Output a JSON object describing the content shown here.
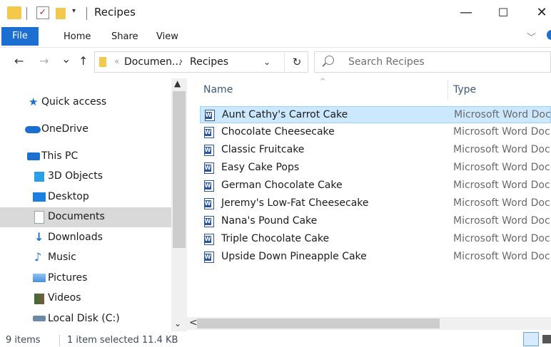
{
  "window": {
    "title": "Recipes",
    "minimize": "—",
    "maximize": "☐",
    "close": "✕"
  },
  "ribbon": {
    "tabs": [
      "File",
      "Home",
      "Share",
      "View"
    ]
  },
  "nav": {
    "back": "←",
    "forward": "→",
    "recent": "⌄",
    "up": "↑",
    "breadcrumb": [
      "Documen...",
      "Recipes"
    ],
    "refresh": "↻",
    "search_placeholder": "Search Recipes"
  },
  "sidebar": {
    "items": [
      {
        "label": "Quick access",
        "icon": "star-icon",
        "color": "#1a6fd0"
      },
      {
        "label": "OneDrive",
        "icon": "cloud-icon",
        "color": "#1a6fd0"
      },
      {
        "label": "This PC",
        "icon": "computer-icon",
        "color": "#1a6fd0"
      },
      {
        "label": "3D Objects",
        "icon": "cube-icon",
        "color": "#2aa0e8"
      },
      {
        "label": "Desktop",
        "icon": "desktop-icon",
        "color": "#1a7fe0"
      },
      {
        "label": "Documents",
        "icon": "documents-icon",
        "color": "#9aa4ad",
        "selected": true
      },
      {
        "label": "Downloads",
        "icon": "download-arrow-icon",
        "color": "#1a6fd0"
      },
      {
        "label": "Music",
        "icon": "music-note-icon",
        "color": "#1a6fd0"
      },
      {
        "label": "Pictures",
        "icon": "pictures-icon",
        "color": "#4a90d9"
      },
      {
        "label": "Videos",
        "icon": "videos-icon",
        "color": "#3a6e3a"
      },
      {
        "label": "Local Disk (C:)",
        "icon": "disk-icon",
        "color": "#6a8aaa"
      }
    ]
  },
  "list": {
    "columns": {
      "name": "Name",
      "type": "Type"
    },
    "files": [
      {
        "name": "Aunt Cathy's Carrot Cake",
        "type": "Microsoft Word Doc...",
        "selected": true
      },
      {
        "name": "Chocolate Cheesecake",
        "type": "Microsoft Word Doc..."
      },
      {
        "name": "Classic Fruitcake",
        "type": "Microsoft Word Doc..."
      },
      {
        "name": "Easy Cake Pops",
        "type": "Microsoft Word Doc..."
      },
      {
        "name": "German Chocolate Cake",
        "type": "Microsoft Word Doc..."
      },
      {
        "name": "Jeremy's Low-Fat Cheesecake",
        "type": "Microsoft Word Doc..."
      },
      {
        "name": "Nana's Pound Cake",
        "type": "Microsoft Word Doc..."
      },
      {
        "name": "Triple Chocolate Cake",
        "type": "Microsoft Word Doc..."
      },
      {
        "name": "Upside Down Pineapple Cake",
        "type": "Microsoft Word Doc..."
      }
    ]
  },
  "status": {
    "items": "9 items",
    "selection": "1 item selected  11.4 KB"
  },
  "colors": {
    "accent": "#1a6fd0",
    "selection_bg": "#cce8ff",
    "folder": "#f2c94c"
  }
}
